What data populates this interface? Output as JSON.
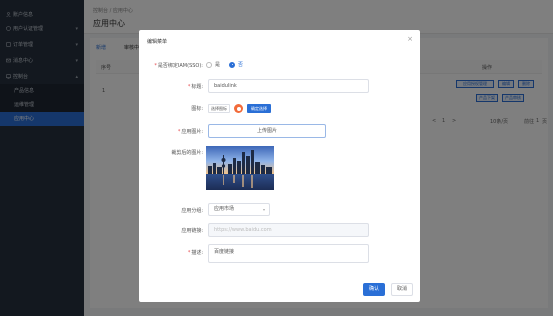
{
  "sidebar": {
    "items": [
      {
        "label": "账户信息",
        "chevron": "",
        "icon": "user-icon"
      },
      {
        "label": "用户认证管理",
        "chevron": "▾",
        "icon": "shield-icon"
      },
      {
        "label": "订单管理",
        "chevron": "▾",
        "icon": "order-icon"
      },
      {
        "label": "消息中心",
        "chevron": "▾",
        "icon": "message-icon"
      },
      {
        "label": "控制台",
        "chevron": "▴",
        "icon": "console-icon"
      }
    ],
    "sub_items": [
      {
        "label": "产品信息"
      },
      {
        "label": "运维管理"
      },
      {
        "label": "应用中心",
        "active": true
      }
    ]
  },
  "header": {
    "breadcrumb": "控制台  /  应用中心",
    "title": "应用中心"
  },
  "background": {
    "add_label": "新增",
    "tab_label": "审核中",
    "col_index": "序号",
    "col_action": "操作",
    "row_index": "1",
    "row_text": "b",
    "actions": [
      "应用授权管理",
      "编辑",
      "删除",
      "产品下架",
      "产品审核"
    ],
    "pager_prev": "<",
    "pager_page": "1",
    "pager_next": ">",
    "page_size": "10条/页",
    "goto_label": "前往",
    "goto_value": "1",
    "page_unit": "页"
  },
  "dialog": {
    "title": "编辑菜单",
    "close": "×",
    "iam_label": "是否绑定IAM(SSO):",
    "iam_options": [
      {
        "label": "是",
        "selected": false
      },
      {
        "label": "否",
        "selected": true
      }
    ],
    "name_label": "标题:",
    "name_value": "baidulink",
    "icon_label": "图标:",
    "choose_icon": "选择图标",
    "confirm_icon": "确定选择",
    "upload_label": "应用图片:",
    "upload_button": "上传图片",
    "cropped_label": "裁剪后的图片:",
    "category_label": "应用分组:",
    "category_value": "应用市场",
    "link_label": "应用链接:",
    "link_placeholder": "https://www.baidu.com",
    "desc_label": "描述:",
    "desc_value": "百度链接",
    "ok_label": "确认",
    "cancel_label": "取消"
  }
}
